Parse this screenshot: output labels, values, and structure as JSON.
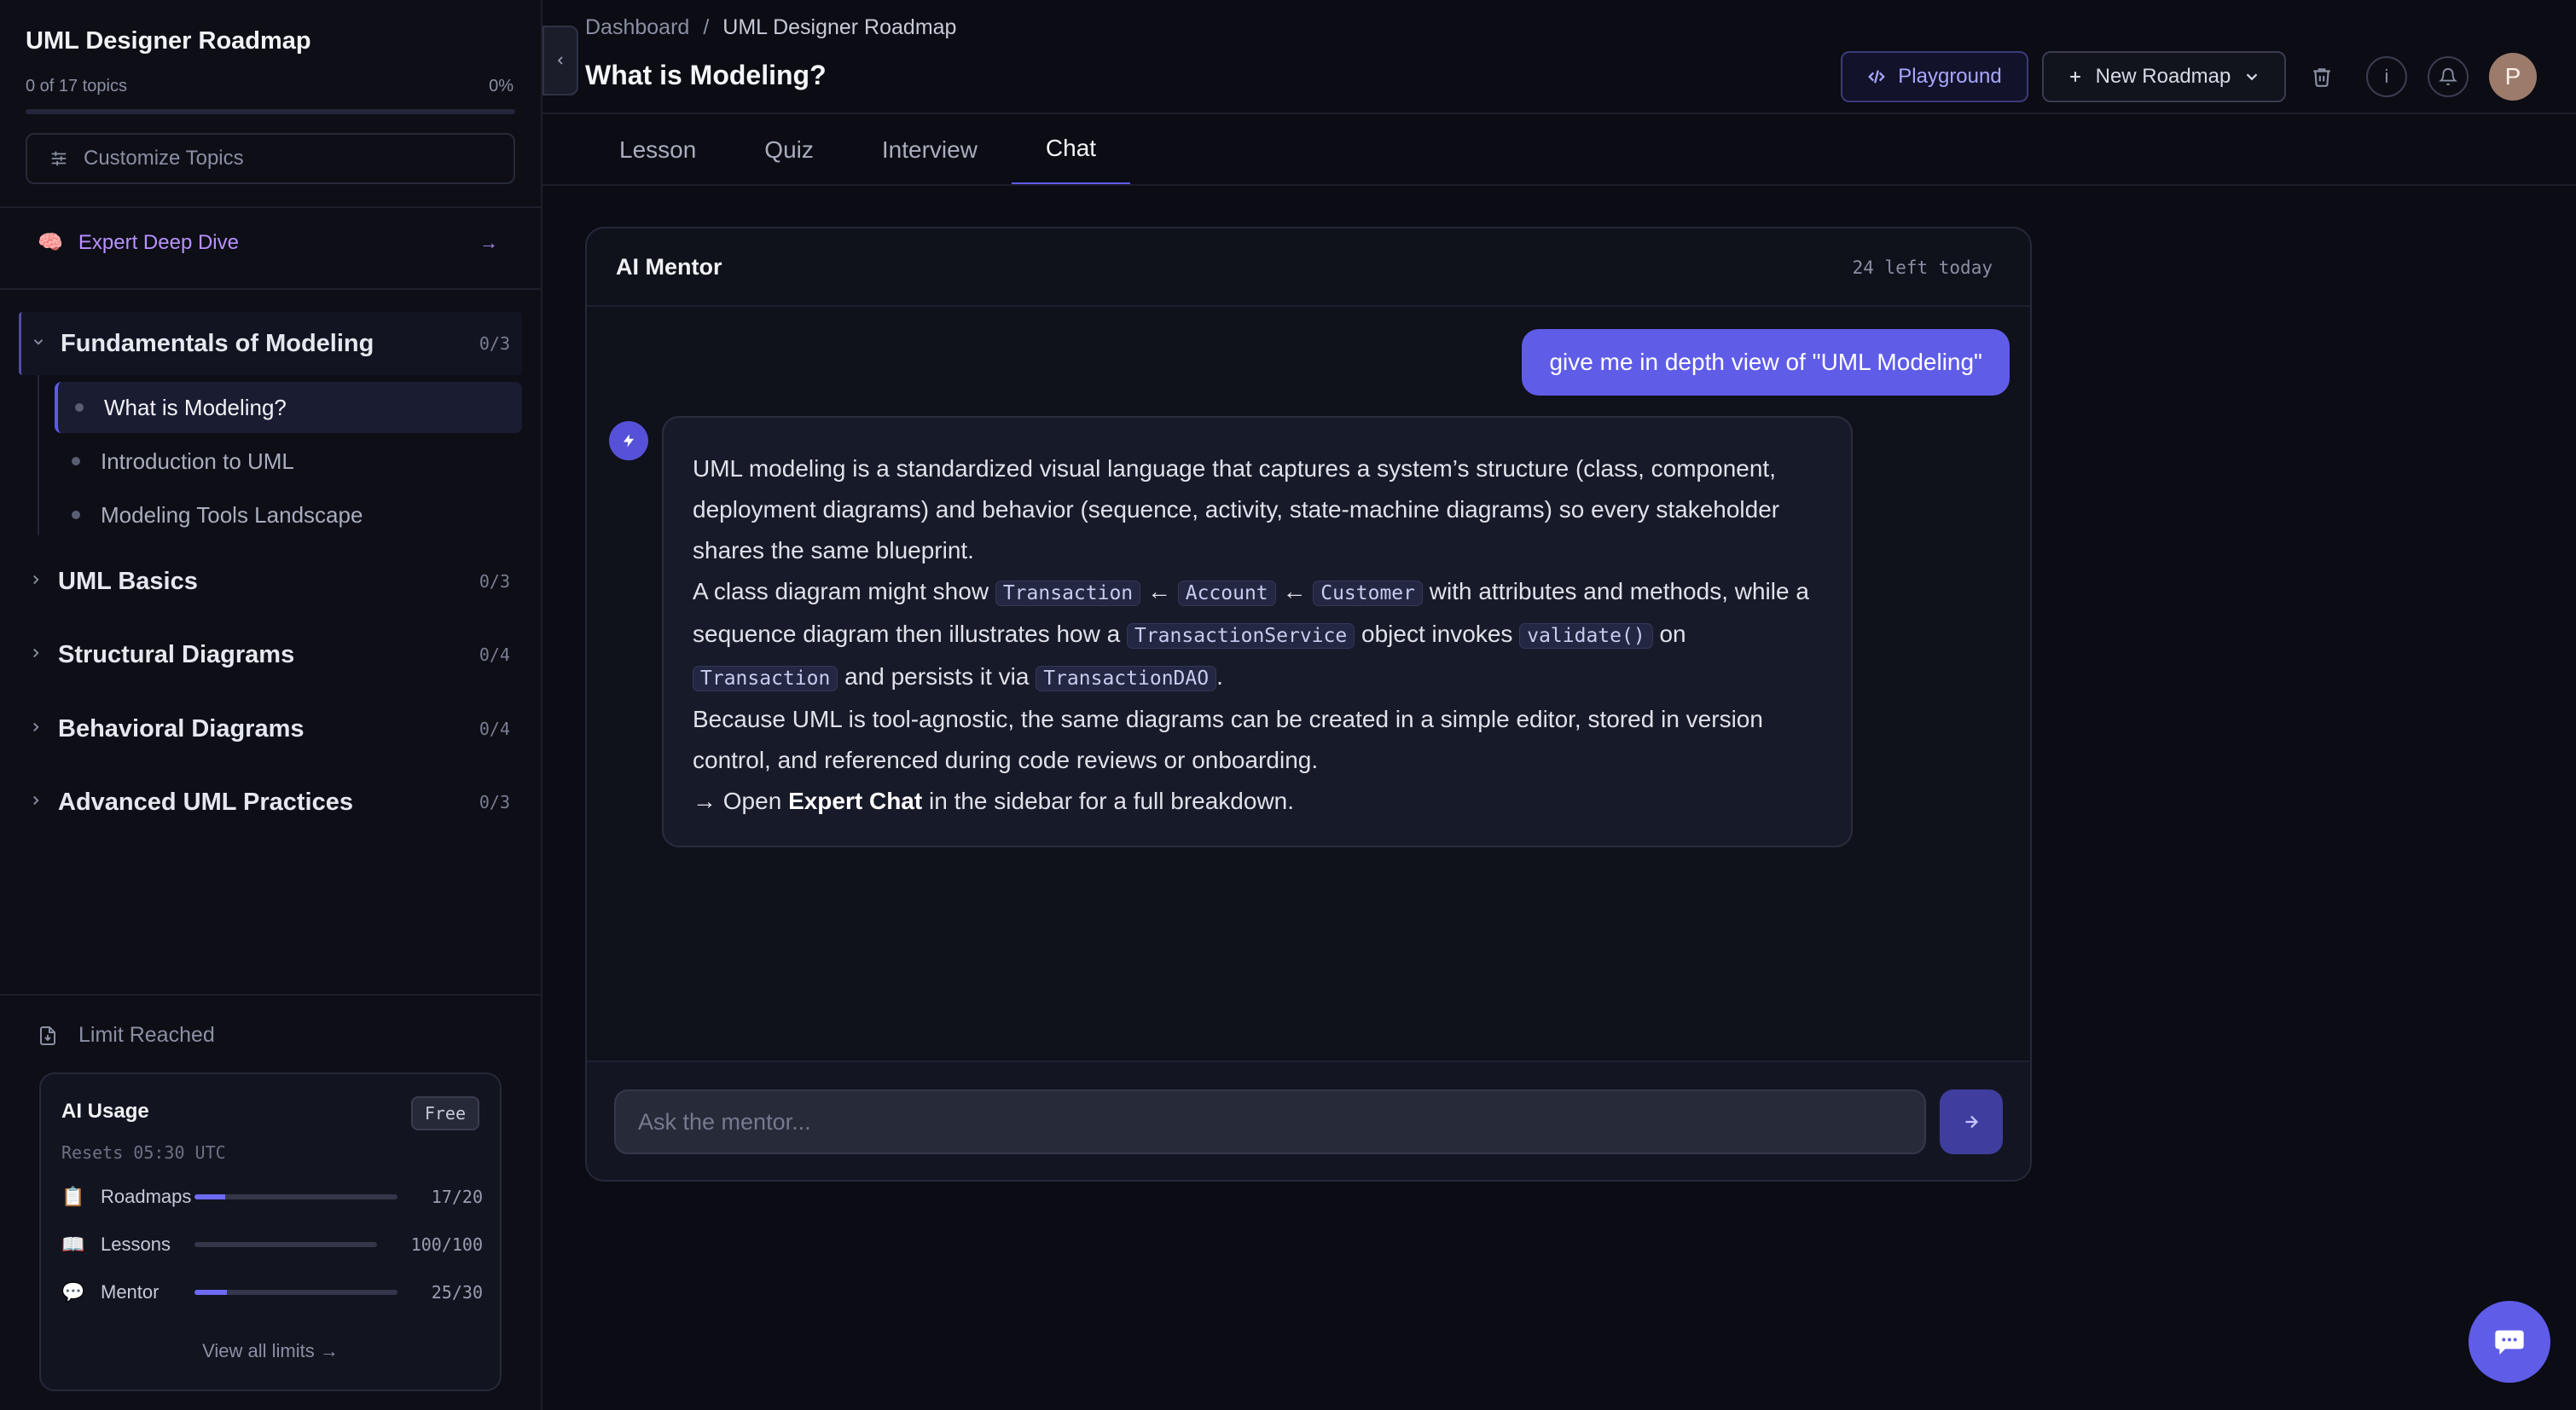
{
  "sidebar": {
    "title": "UML Designer Roadmap",
    "progress_text": "0 of 17 topics",
    "progress_pct": "0%",
    "progress_value": 0,
    "customize_label": "Customize Topics",
    "deep_dive_label": "Expert Deep Dive",
    "deep_dive_icon": "🧠",
    "sections": [
      {
        "label": "Fundamentals of Modeling",
        "count": "0/3",
        "open": true,
        "topics": [
          {
            "label": "What is Modeling?",
            "active": true
          },
          {
            "label": "Introduction to UML",
            "active": false
          },
          {
            "label": "Modeling Tools Landscape",
            "active": false
          }
        ]
      },
      {
        "label": "UML Basics",
        "count": "0/3",
        "open": false
      },
      {
        "label": "Structural Diagrams",
        "count": "0/4",
        "open": false
      },
      {
        "label": "Behavioral Diagrams",
        "count": "0/4",
        "open": false
      },
      {
        "label": "Advanced UML Practices",
        "count": "0/3",
        "open": false
      }
    ],
    "limit_label": "Limit Reached",
    "usage": {
      "title": "AI Usage",
      "badge": "Free",
      "reset": "Resets 05:30 UTC",
      "rows": [
        {
          "emoji": "📋",
          "label": "Roadmaps",
          "value": "17/20",
          "fill": 0.15
        },
        {
          "emoji": "📖",
          "label": "Lessons",
          "value": "100/100",
          "fill": 0.0
        },
        {
          "emoji": "💬",
          "label": "Mentor",
          "value": "25/30",
          "fill": 0.16
        }
      ],
      "link": "View all limits →"
    }
  },
  "header": {
    "breadcrumb": [
      "Dashboard",
      "UML Designer Roadmap"
    ],
    "breadcrumb_sep": "/",
    "title": "What is Modeling?",
    "playground_label": "Playground",
    "new_roadmap_label": "New Roadmap",
    "avatar_initial": "P"
  },
  "tabs": [
    {
      "label": "Lesson",
      "active": false
    },
    {
      "label": "Quiz",
      "active": false
    },
    {
      "label": "Interview",
      "active": false
    },
    {
      "label": "Chat",
      "active": true
    }
  ],
  "chat": {
    "title": "AI Mentor",
    "remaining": "24 left today",
    "user_message": "give me in depth view of \"UML Modeling\"",
    "bot": {
      "p1": "UML modeling is a standardized visual language that captures a system’s structure (class, component, deployment diagrams) and behavior (sequence, activity, state-machine diagrams) so every stakeholder shares the same blueprint.",
      "p2_a": "A class diagram might show",
      "code_transaction": "Transaction",
      "arrow": "←",
      "code_account": "Account",
      "code_customer": "Customer",
      "p2_b": "with attributes and methods, while a sequence diagram then illustrates how a",
      "code_service": "TransactionService",
      "p2_c": "object invokes",
      "code_validate": "validate()",
      "p2_d": "on",
      "code_transaction2": "Transaction",
      "p2_e": "and persists it via",
      "code_dao": "TransactionDAO",
      "p2_f": ".",
      "p3": "Because UML is tool-agnostic, the same diagrams can be created in a simple editor, stored in version control, and referenced during code reviews or onboarding.",
      "p4_a": "→ Open",
      "p4_strong": "Expert Chat",
      "p4_b": "in the sidebar for a full breakdown."
    },
    "input_placeholder": "Ask the mentor...",
    "input_value": ""
  },
  "colors": {
    "accent": "#5f5ce8",
    "background": "#0b0c14",
    "deep_dive": "#b891ff"
  },
  "icons": {
    "collapse": "chevron-left-icon",
    "playground": "code-icon",
    "new_roadmap": "plus-icon",
    "trash": "trash-icon",
    "info": "info-icon",
    "bell": "bell-icon",
    "send": "arrow-right-icon",
    "fab": "chat-bubble-icon"
  }
}
